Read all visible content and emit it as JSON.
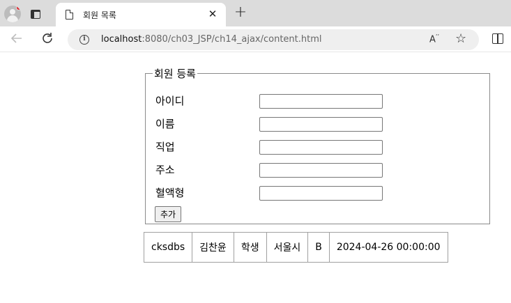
{
  "browser": {
    "tab_title": "회원 목록",
    "tab_close": "✕",
    "new_tab": "+",
    "url_host": "localhost",
    "url_path": ":8080/ch03_JSP/ch14_ajax/content.html",
    "read_aloud": "A",
    "read_aloud_sup": "ʼʼ",
    "icons": [
      "profile-icon",
      "tab-actions-icon",
      "document-icon",
      "close-icon",
      "plus-icon",
      "back-arrow-icon",
      "reload-icon",
      "info-icon",
      "read-aloud-icon",
      "star-icon",
      "split-screen-icon"
    ]
  },
  "form": {
    "legend": "회원 등록",
    "fields": [
      {
        "label": "아이디",
        "value": ""
      },
      {
        "label": "이름",
        "value": ""
      },
      {
        "label": "직업",
        "value": ""
      },
      {
        "label": "주소",
        "value": ""
      },
      {
        "label": "혈액형",
        "value": ""
      }
    ],
    "submit_label": "추가"
  },
  "members": [
    {
      "id": "cksdbs",
      "name": "김찬윤",
      "job": "학생",
      "address": "서울시",
      "blood": "B",
      "date": "2024-04-26 00:00:00"
    }
  ]
}
